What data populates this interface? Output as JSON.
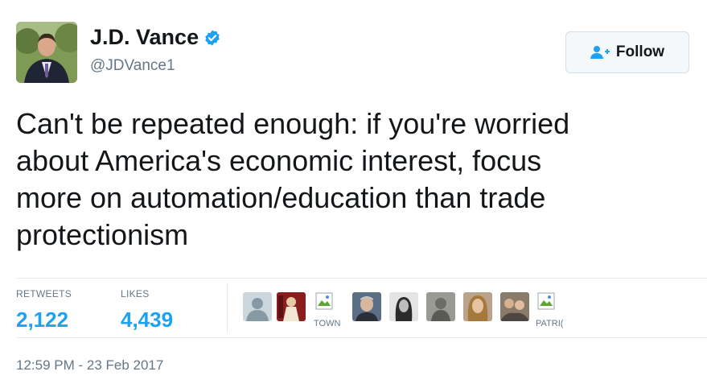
{
  "user": {
    "display_name": "J.D. Vance",
    "handle": "@JDVance1",
    "verified": true
  },
  "follow_button": {
    "label": "Follow"
  },
  "tweet": {
    "text_lines": [
      "Can't be repeated enough: if you're worried",
      "about America's economic interest, focus",
      "more on automation/education than trade",
      "protectionism"
    ]
  },
  "stats": {
    "retweets_label": "RETWEETS",
    "retweets_value": "2,122",
    "likes_label": "LIKES",
    "likes_value": "4,439"
  },
  "likers": {
    "labels": [
      "TOWN",
      "PATRI("
    ]
  },
  "timestamp": "12:59 PM - 23 Feb 2017",
  "colors": {
    "accent": "#1da1f2",
    "muted": "#657786",
    "text": "#14171a",
    "border": "#e6ecf0"
  },
  "icons": [
    "verified-badge-icon",
    "follow-person-icon",
    "broken-image-icon"
  ]
}
